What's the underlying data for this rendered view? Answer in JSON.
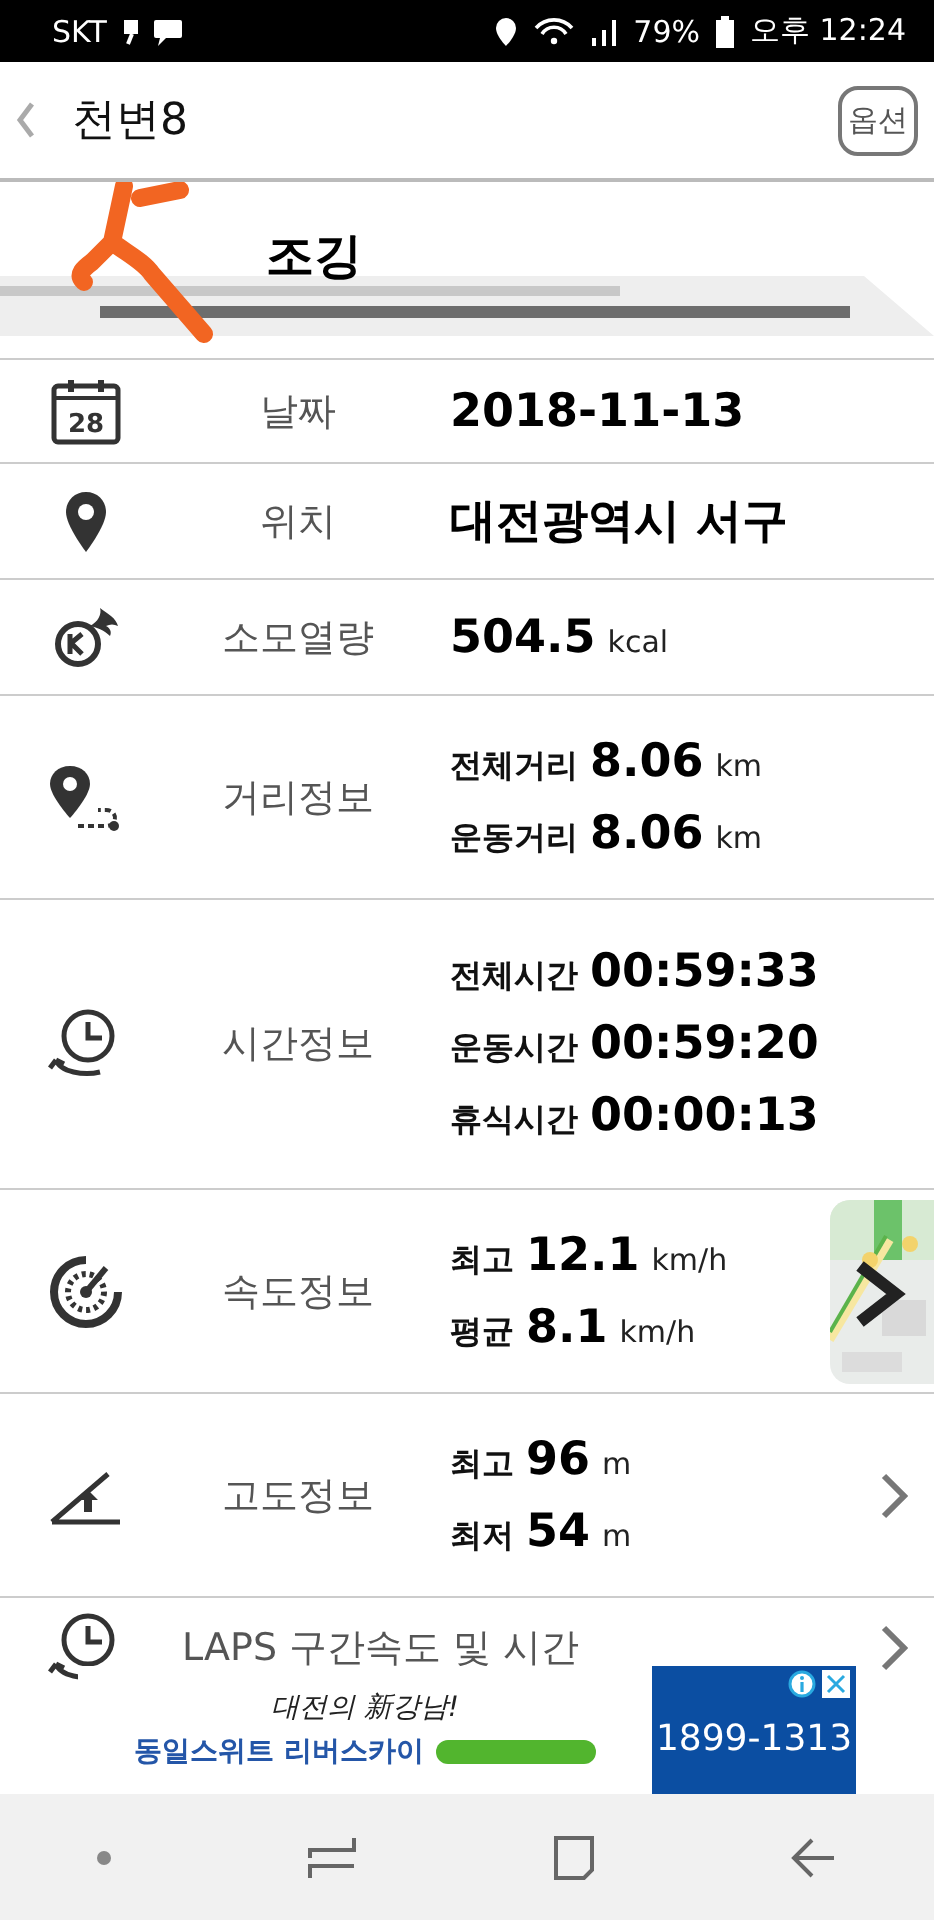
{
  "status_bar": {
    "carrier": "SKT",
    "battery": "79%",
    "time": "오후 12:24"
  },
  "header": {
    "title": "천변8",
    "option_button": "옵션"
  },
  "activity": {
    "name": "조깅"
  },
  "rows": [
    {
      "kind": "single",
      "icon_text": "28",
      "label": "날짜",
      "value": "2018-11-13"
    },
    {
      "kind": "single",
      "label": "위치",
      "value": "대전광역시 서구"
    },
    {
      "kind": "single",
      "label": "소모열량",
      "value": "504.5",
      "unit": "kcal"
    },
    {
      "kind": "multi",
      "label": "거리정보",
      "items": [
        {
          "label": "전체거리",
          "value": "8.06",
          "unit": "km"
        },
        {
          "label": "운동거리",
          "value": "8.06",
          "unit": "km"
        }
      ]
    },
    {
      "kind": "multi",
      "label": "시간정보",
      "items": [
        {
          "label": "전체시간",
          "value": "00:59:33"
        },
        {
          "label": "운동시간",
          "value": "00:59:20"
        },
        {
          "label": "휴식시간",
          "value": "00:00:13"
        }
      ]
    },
    {
      "kind": "multi",
      "label": "속도정보",
      "items": [
        {
          "label": "최고",
          "value": "12.1",
          "unit": "km/h"
        },
        {
          "label": "평균",
          "value": "8.1",
          "unit": "km/h"
        }
      ]
    },
    {
      "kind": "multi",
      "label": "고도정보",
      "items": [
        {
          "label": "최고",
          "value": "96",
          "unit": "m"
        },
        {
          "label": "최저",
          "value": "54",
          "unit": "m"
        }
      ]
    },
    {
      "kind": "wide",
      "label": "LAPS 구간속도 및 시간"
    }
  ],
  "ad": {
    "headline": "대전의 新강남!",
    "brand": "동일스위트 리버스카이",
    "phone": "1899-1313"
  }
}
